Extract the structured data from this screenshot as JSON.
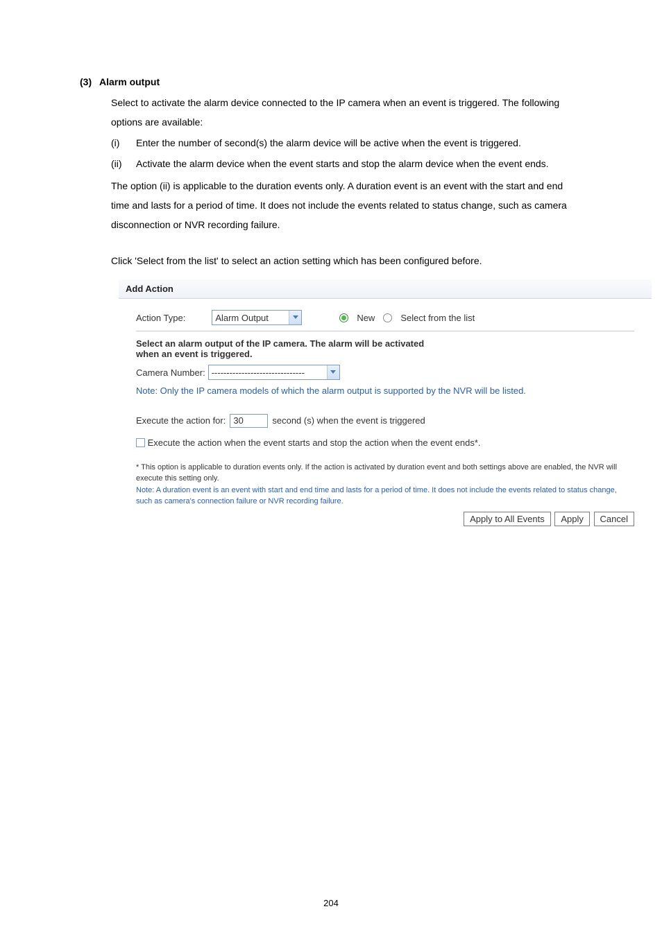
{
  "doc": {
    "heading_num": "(3)",
    "heading_text": "Alarm output",
    "para1": "Select to activate the alarm device connected to the IP camera when an event is triggered.   The following options are available:",
    "item_i_marker": "(i)",
    "item_i_text": "Enter the number of second(s) the alarm device will be active when the event is triggered.",
    "item_ii_marker": "(ii)",
    "item_ii_text": "Activate the alarm device when the event starts and stop the alarm device when the event ends.",
    "para2": "The option (ii) is applicable to the duration events only.   A duration event is an event with the start and end time and lasts for a period of time.   It does not include the events related to status change, such as camera disconnection or NVR recording failure.",
    "para3": "Click 'Select from the list' to select an action setting which has been configured before."
  },
  "dialog": {
    "title": "Add Action",
    "action_type_label": "Action Type:",
    "action_type_value": "Alarm Output",
    "radio_new": "New",
    "radio_select": "Select from the list",
    "heading_line1": "Select an alarm output of the IP camera. The alarm will be activated",
    "heading_line2": "when an event is triggered.",
    "camera_number_label": "Camera Number:",
    "camera_number_value": "-------------------------------",
    "note_supported": "Note: Only the IP camera models of which the alarm output is supported by the NVR will be listed.",
    "execute_label_pre": "Execute the action for:",
    "execute_seconds": "30",
    "execute_label_post": "second (s) when the event is triggered",
    "checkbox_text": "Execute the action when the event starts and stop the action when the event ends*.",
    "footnote_black": "* This option is applicable to duration events only. If the action is activated by duration event and both settings above are enabled, the NVR will execute this setting only.",
    "footnote_blue": "Note: A duration event is an event with start and end time and lasts for a period of time. It does not include the events related to status change, such as camera's connection failure or NVR recording failure.",
    "btn_apply_all": "Apply to All Events",
    "btn_apply": "Apply",
    "btn_cancel": "Cancel"
  },
  "page_number": "204"
}
